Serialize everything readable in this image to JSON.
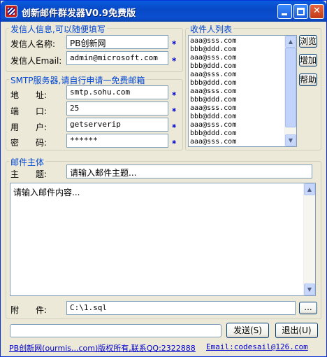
{
  "window": {
    "title": "创新邮件群发器V0.9免费版",
    "min_glyph": "_",
    "close_glyph": "✕"
  },
  "sender": {
    "group_title": "发信人信息,可以随便填写",
    "name_label": "发信人名称:",
    "name_value": "PB创新网",
    "email_label": "发信人Email:",
    "email_value": "admin@microsoft.com",
    "required_mark": "*"
  },
  "smtp": {
    "group_title": "SMTP服务器,请自行申请一免费邮箱",
    "address_label": "地　　址:",
    "address_value": "smtp.sohu.com",
    "port_label": "端　　口:",
    "port_value": "25",
    "user_label": "用　　户:",
    "user_value": "getserverip",
    "password_label": "密　　码:",
    "password_value": "******",
    "required_mark": "*"
  },
  "recipients": {
    "group_title": "收件人列表",
    "items": [
      "aaa@sss.com",
      "bbb@ddd.com",
      "aaa@sss.com",
      "bbb@ddd.com",
      "aaa@sss.com",
      "bbb@ddd.com",
      "aaa@sss.com",
      "bbb@ddd.com",
      "aaa@sss.com",
      "bbb@ddd.com",
      "aaa@sss.com",
      "bbb@ddd.com",
      "aaa@sss.com"
    ],
    "browse_label": "浏览",
    "add_label": "增加",
    "help_label": "帮助",
    "scroll_up_glyph": "▲",
    "scroll_down_glyph": "▼"
  },
  "mail": {
    "group_title": "邮件主体",
    "subject_label": "主　　题:",
    "subject_value": "请输入邮件主题...",
    "body_value": "请输入邮件内容...",
    "attachment_label": "附　　件:",
    "attachment_value": "C:\\1.sql",
    "attach_browse_label": "...",
    "scroll_up_glyph": "▲",
    "scroll_down_glyph": "▼"
  },
  "actions": {
    "send_label": "发送(S)",
    "exit_label": "退出(U)"
  },
  "footer": {
    "copyright_link": "PB创新网(ourmis...com)版权所有,联系QQ:2322888",
    "email_link": "Email:codesail@126.com"
  }
}
